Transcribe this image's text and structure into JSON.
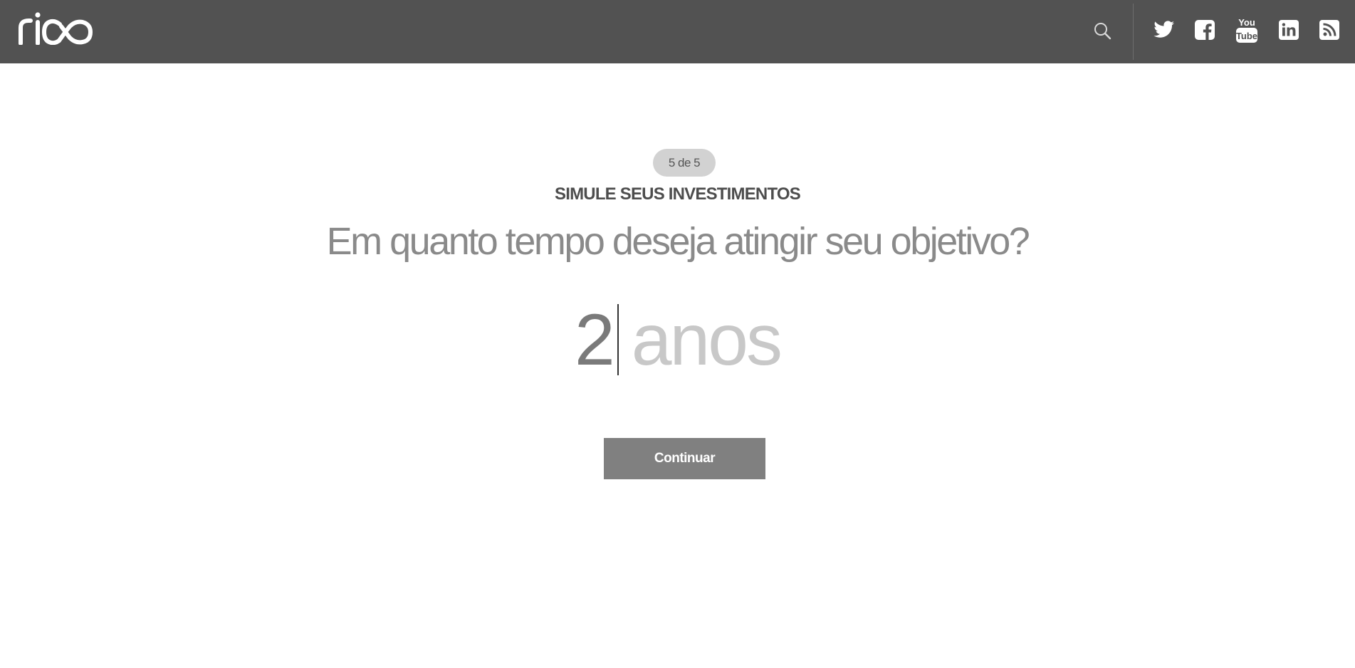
{
  "header": {
    "logo_text": "rico",
    "search_icon": "search-icon",
    "social_icons": [
      "twitter-icon",
      "facebook-icon",
      "youtube-icon",
      "linkedin-icon",
      "rss-icon"
    ]
  },
  "main": {
    "step_label": "5 de 5",
    "section_title": "SIMULE SEUS INVESTIMENTOS",
    "question": "Em quanto tempo deseja atingir seu objetivo?",
    "answer_value": "2",
    "answer_unit": "anos",
    "continue_label": "Continuar"
  },
  "colors": {
    "header_bg": "#525252",
    "badge_bg": "#d2d2d2",
    "button_bg": "#808080",
    "text_dark": "#4d4d4d",
    "text_muted": "#8a8a8a",
    "text_placeholder": "#c8c8c8"
  }
}
